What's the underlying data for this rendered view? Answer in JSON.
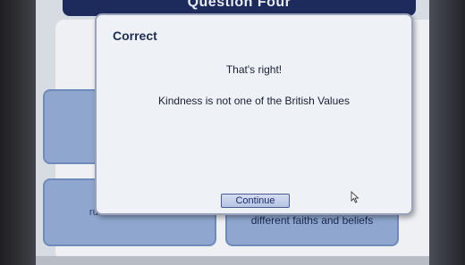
{
  "header": {
    "title": "Question Four"
  },
  "cards": [
    {
      "text": ""
    },
    {
      "text": ""
    },
    {
      "text": "rule of law"
    },
    {
      "text": "different faiths and beliefs"
    }
  ],
  "dialog": {
    "title": "Correct",
    "line1": "That's right!",
    "line2": "Kindness is not one of the British Values",
    "continue_label": "Continue"
  },
  "icons": {
    "pointer": "mouse-pointer-icon"
  }
}
